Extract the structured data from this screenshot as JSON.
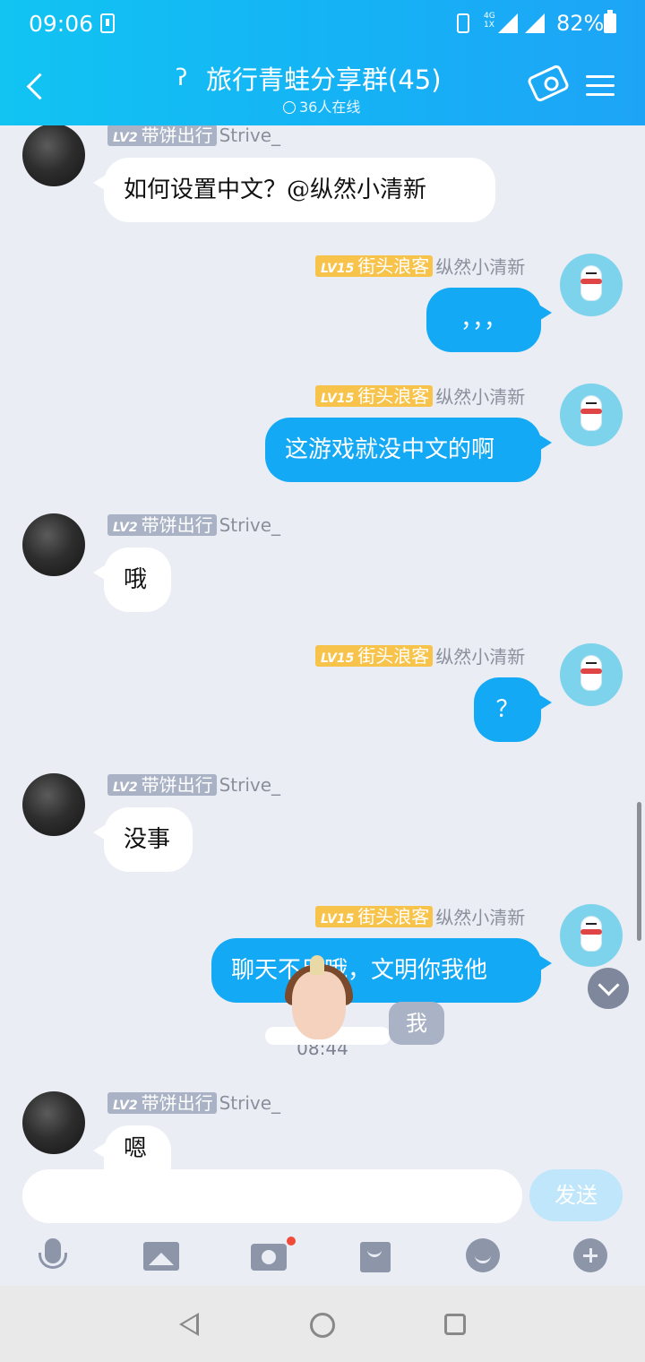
{
  "status_bar": {
    "time": "09:06",
    "network": "4G 1X",
    "battery": "82%"
  },
  "header": {
    "title": "旅行青蛙分享群(45)",
    "online": "36人在线",
    "accent": "#14a9f5"
  },
  "users": {
    "strive": {
      "level": "LV2",
      "title": "带饼出行",
      "name": "Strive_"
    },
    "zongran": {
      "level": "LV15",
      "title": "街头浪客",
      "name": "纵然小清新"
    }
  },
  "messages": [
    {
      "text": "如何设置中文？@纵然小清新"
    },
    {
      "text": "，，，"
    },
    {
      "text": "这游戏就没中文的啊"
    },
    {
      "text": "哦"
    },
    {
      "text": "？"
    },
    {
      "text": "没事"
    },
    {
      "text": "聊天不用哦，文明你我他"
    },
    {
      "text": "嗯"
    }
  ],
  "timestamp": "08:44",
  "sticker_text": "我",
  "input": {
    "placeholder": "",
    "send_label": "发送"
  }
}
